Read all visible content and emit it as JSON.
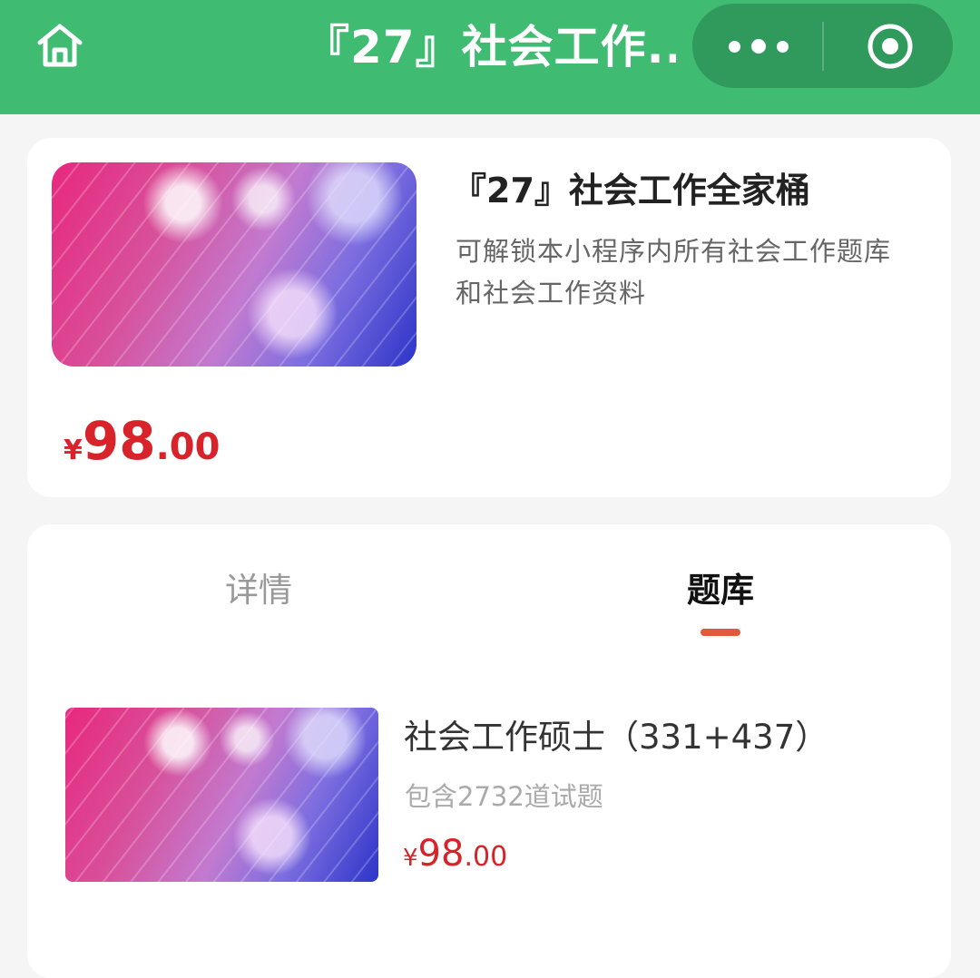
{
  "navbar": {
    "title": "『27』社会工作...",
    "home_icon": "home-icon",
    "more_icon": "more-dots-icon",
    "close_icon": "miniprogram-close-icon",
    "bg_color": "#3fbb72"
  },
  "product": {
    "title": "『27』社会工作全家桶",
    "description": "可解锁本小程序内所有社会工作题库和社会工作资料",
    "price": {
      "symbol": "¥",
      "integer": "98",
      "decimal": ".00"
    },
    "price_color": "#d8232a"
  },
  "tabs": {
    "items": [
      {
        "label": "详情",
        "active": false
      },
      {
        "label": "题库",
        "active": true
      }
    ],
    "indicator_color": "#e15a3b"
  },
  "question_bank": {
    "items": [
      {
        "title": "社会工作硕士（331+437）",
        "subtitle": "包含2732道试题",
        "price": {
          "symbol": "¥",
          "integer": "98",
          "decimal": ".00"
        }
      }
    ]
  }
}
